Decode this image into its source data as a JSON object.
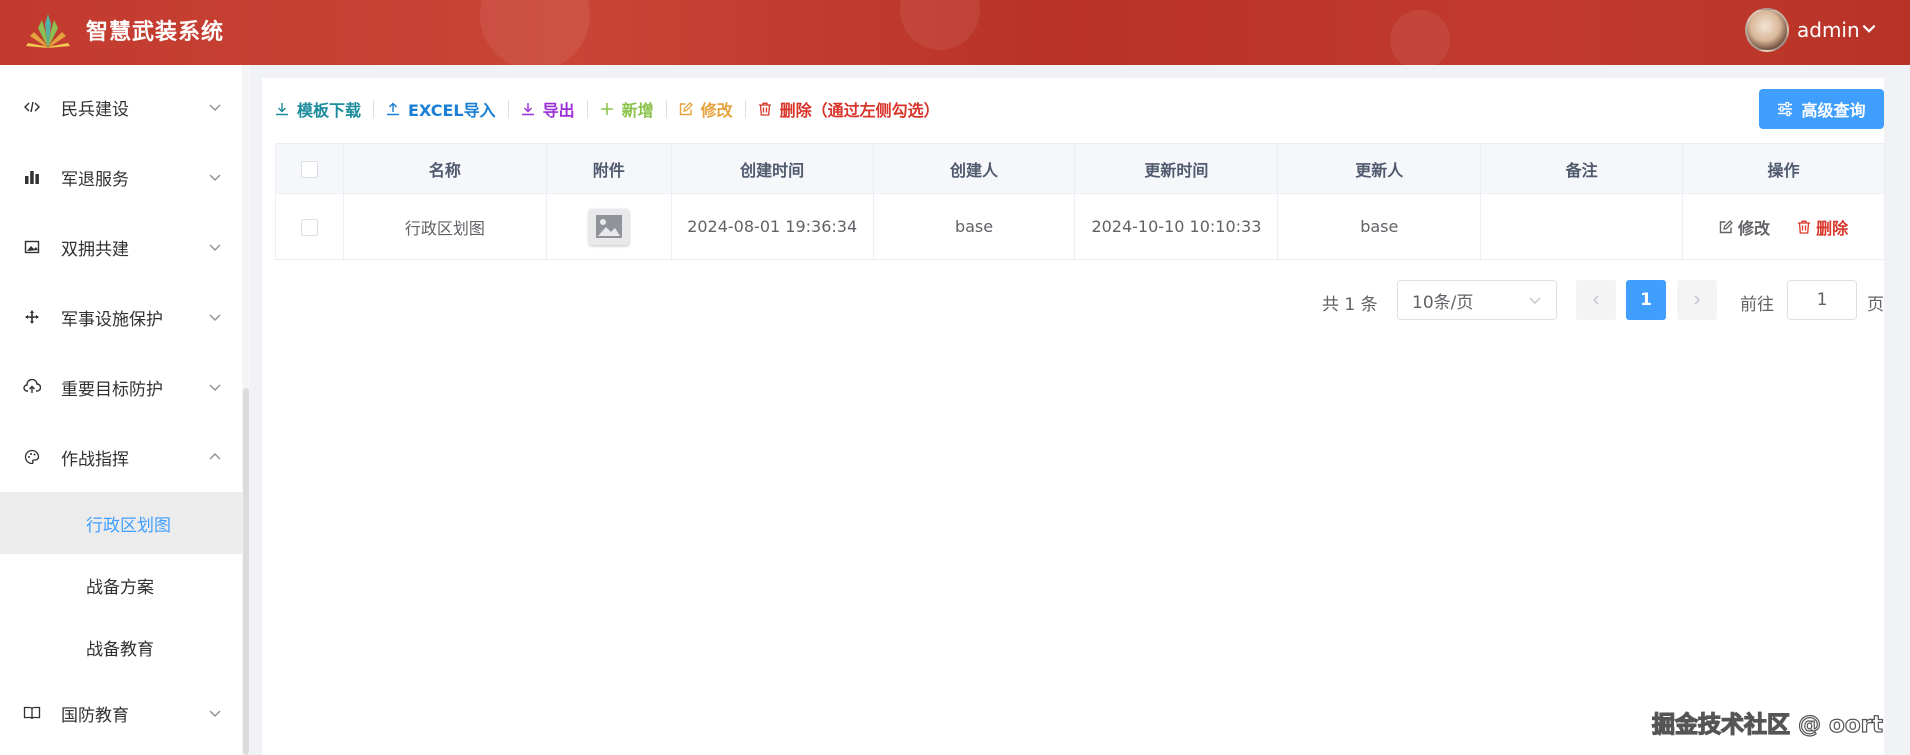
{
  "header": {
    "app_title": "智慧武装系统",
    "user_name": "admin"
  },
  "sidebar": {
    "items": [
      {
        "label": "民兵建设",
        "icon": "code-icon"
      },
      {
        "label": "军退服务",
        "icon": "bar-chart-icon"
      },
      {
        "label": "双拥共建",
        "icon": "picture-icon"
      },
      {
        "label": "军事设施保护",
        "icon": "move-icon"
      },
      {
        "label": "重要目标防护",
        "icon": "cloud-upload-icon"
      },
      {
        "label": "作战指挥",
        "icon": "palette-icon",
        "expanded": true
      },
      {
        "label": "国防教育",
        "icon": "book-icon"
      }
    ],
    "sub_items": [
      {
        "label": "行政区划图",
        "active": true
      },
      {
        "label": "战备方案",
        "active": false
      },
      {
        "label": "战备教育",
        "active": false
      }
    ]
  },
  "toolbar": {
    "template_download": "模板下载",
    "excel_import": "EXCEL导入",
    "export": "导出",
    "add": "新增",
    "edit": "修改",
    "delete": "删除（通过左侧勾选）",
    "advanced_query": "高级查询",
    "colors": {
      "download": "#1c8c9c",
      "import": "#1a7fd4",
      "export": "#9b30d9",
      "add": "#8bc34a",
      "edit": "#e6a23c",
      "delete": "#d9362b"
    }
  },
  "table": {
    "columns": [
      "名称",
      "附件",
      "创建时间",
      "创建人",
      "更新时间",
      "更新人",
      "备注",
      "操作"
    ],
    "rows": [
      {
        "name": "行政区划图",
        "attachment": "image-thumbnail",
        "created_at": "2024-08-01 19:36:34",
        "creator": "base",
        "updated_at": "2024-10-10 10:10:33",
        "updater": "base",
        "remark": "",
        "edit_label": "修改",
        "delete_label": "删除"
      }
    ]
  },
  "pagination": {
    "total_text": "共 1 条",
    "page_size": "10条/页",
    "current_page": "1",
    "goto_prefix": "前往",
    "goto_value": "1",
    "goto_suffix": "页"
  },
  "watermark": "掘金技术社区 @ oort",
  "colors": {
    "header": "#c23a2e",
    "accent": "#409eff",
    "delete": "#d9362b"
  }
}
